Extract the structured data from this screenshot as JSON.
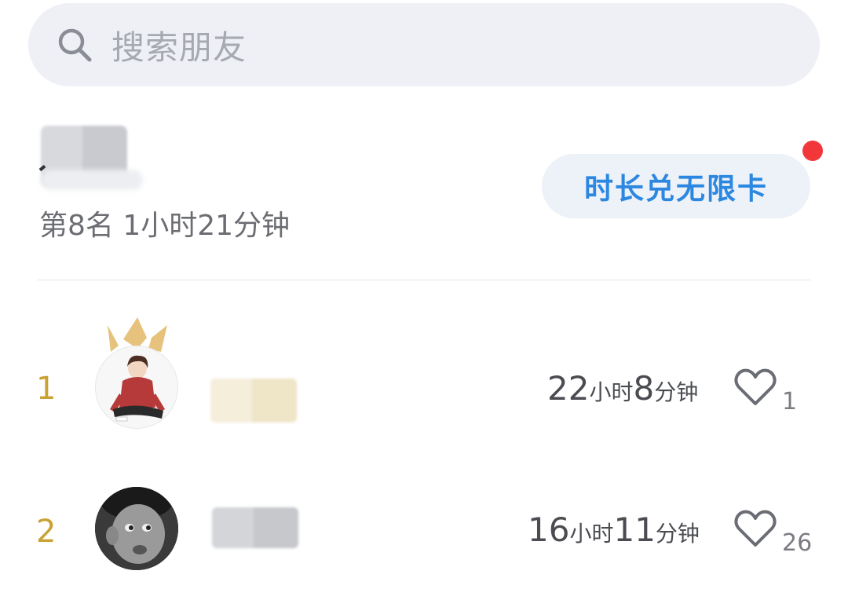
{
  "search": {
    "placeholder": "搜索朋友"
  },
  "me": {
    "rank_text": "第8名 1小时21分钟"
  },
  "promo": {
    "label": "时长兑无限卡"
  },
  "ranking": [
    {
      "rank": "1",
      "hours": "22",
      "hours_unit": "小时",
      "minutes": "8",
      "minutes_unit": "分钟",
      "likes": "1"
    },
    {
      "rank": "2",
      "hours": "16",
      "hours_unit": "小时",
      "minutes": "11",
      "minutes_unit": "分钟",
      "likes": "26"
    }
  ],
  "colors": {
    "accent": "#2c87e1",
    "gold": "#c9a233",
    "badge": "#f2373b"
  }
}
